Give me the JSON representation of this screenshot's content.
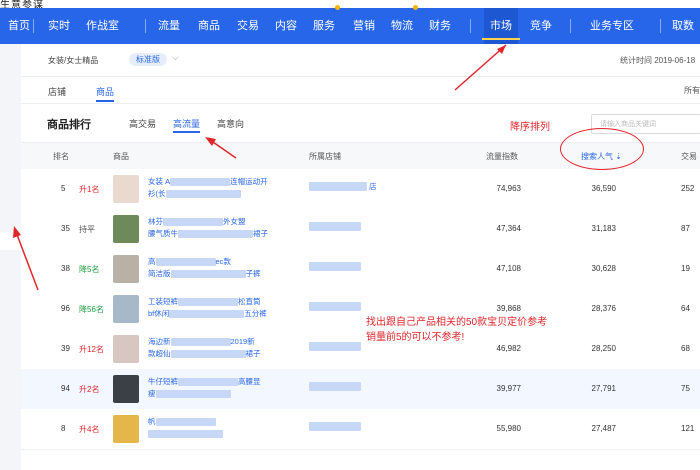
{
  "window_title": "生意参谋",
  "nav": {
    "items": [
      "首页",
      "实时",
      "作战室",
      "流量",
      "商品",
      "交易",
      "内容",
      "服务",
      "营销",
      "物流",
      "财务",
      "市场",
      "竞争",
      "业务专区",
      "取数"
    ],
    "active": "市场"
  },
  "breadcrumb": {
    "category": "女装/女士精品",
    "edition": "标准版",
    "date_label": "统计时间 2019-06-18"
  },
  "subtabs": {
    "items": [
      "店铺",
      "商品"
    ],
    "active": "商品",
    "right_label": "所有"
  },
  "panel": {
    "title": "商品排行",
    "tabs": [
      "高交易",
      "高流量",
      "高意向"
    ],
    "active_tab": "高流量",
    "search_placeholder": "请输入商品关键词"
  },
  "table": {
    "headers": {
      "rank": "排名",
      "product": "商品",
      "shop": "所属店铺",
      "traffic": "流量指数",
      "search": "搜索人气 ⇣",
      "trade": "交易"
    },
    "rows": [
      {
        "rank": "5",
        "change": "升1名",
        "dir": "up",
        "name1": "女装 A",
        "name1b": "连帽运动开",
        "name2": "衫(长",
        "shop_suffix": "店",
        "traffic": "74,963",
        "search": "36,590",
        "trade": "252"
      },
      {
        "rank": "35",
        "change": "持平",
        "dir": "flat",
        "name1": "林芬",
        "name1b": "外女盟",
        "name2": "腰气质牛",
        "name2b": "裙子",
        "shop_suffix": "",
        "traffic": "47,364",
        "search": "31,183",
        "trade": "87"
      },
      {
        "rank": "38",
        "change": "降5名",
        "dir": "down",
        "name1": "高",
        "name1b": "ec款",
        "name2": "简洁版",
        "name2b": "子裤",
        "shop_suffix": "",
        "traffic": "47,108",
        "search": "30,628",
        "trade": "19"
      },
      {
        "rank": "96",
        "change": "降56名",
        "dir": "down",
        "name1": "工装短裤",
        "name1b": "松直筒",
        "name2": "bf休闲",
        "name2b": "五分裤",
        "shop_suffix": "",
        "traffic": "39,868",
        "search": "28,376",
        "trade": "64"
      },
      {
        "rank": "39",
        "change": "升12名",
        "dir": "up",
        "name1": "海边新",
        "name1b": "2019新",
        "name2": "款超仙",
        "name2b": "裙子",
        "shop_suffix": "",
        "traffic": "46,982",
        "search": "28,250",
        "trade": "68"
      },
      {
        "rank": "94",
        "change": "升2名",
        "dir": "up",
        "name1": "牛仔短裤",
        "name1b": "高腰显",
        "name2": "瘦",
        "name2b": "",
        "shop_suffix": "",
        "traffic": "39,977",
        "search": "27,791",
        "trade": "75"
      },
      {
        "rank": "8",
        "change": "升4名",
        "dir": "up",
        "name1": "帆",
        "name1b": "",
        "name2": "",
        "name2b": "",
        "shop_suffix": "",
        "traffic": "55,980",
        "search": "27,487",
        "trade": "121"
      }
    ]
  },
  "annotations": {
    "sort_note": "降序排列",
    "note_line1": "找出跟自己产品相关的50款宝贝定价参考",
    "note_line2": "销量前5的可以不参考!"
  },
  "colors": {
    "nav_bg": "#2766e8",
    "accent": "#2766e8",
    "up": "#e0262a",
    "down": "#1a9c3c",
    "annot": "#e0262a"
  }
}
